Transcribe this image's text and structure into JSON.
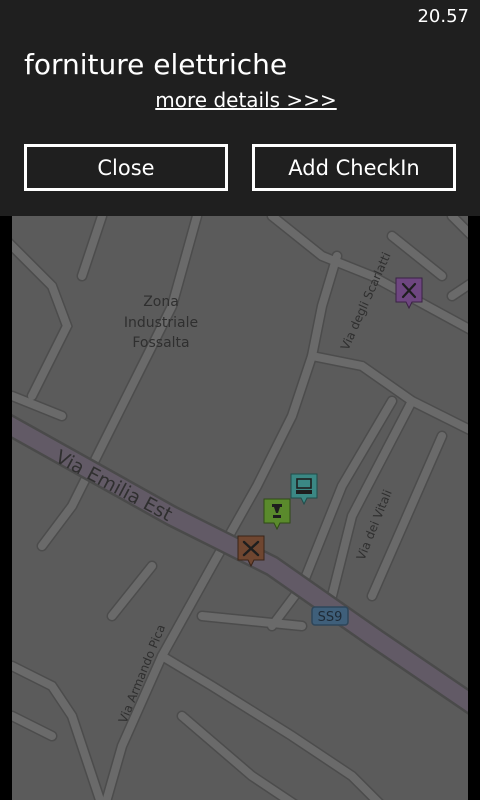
{
  "status": {
    "time": "20.57"
  },
  "place": {
    "name": "forniture elettriche",
    "details_link": "more details >>>"
  },
  "buttons": {
    "close": "Close",
    "add_checkin": "Add CheckIn"
  },
  "map": {
    "area_label": [
      "Zona",
      "Industriale",
      "Fossalta"
    ],
    "streets": {
      "via_emilia_est": "Via Emilia Est",
      "via_scarlatti": "Via degli Scarlatti",
      "via_vitali": "Via dei Vitali",
      "via_armando_pica": "Via Armando Pica"
    },
    "road_shield": "SS9",
    "pins": [
      {
        "icon": "restaurant-icon",
        "color": "#7a4e8c"
      },
      {
        "icon": "computer-shop-icon",
        "color": "#3f8f8a"
      },
      {
        "icon": "museum-icon",
        "color": "#5e8f2e"
      },
      {
        "icon": "tools-icon",
        "color": "#7a4e32"
      }
    ]
  }
}
